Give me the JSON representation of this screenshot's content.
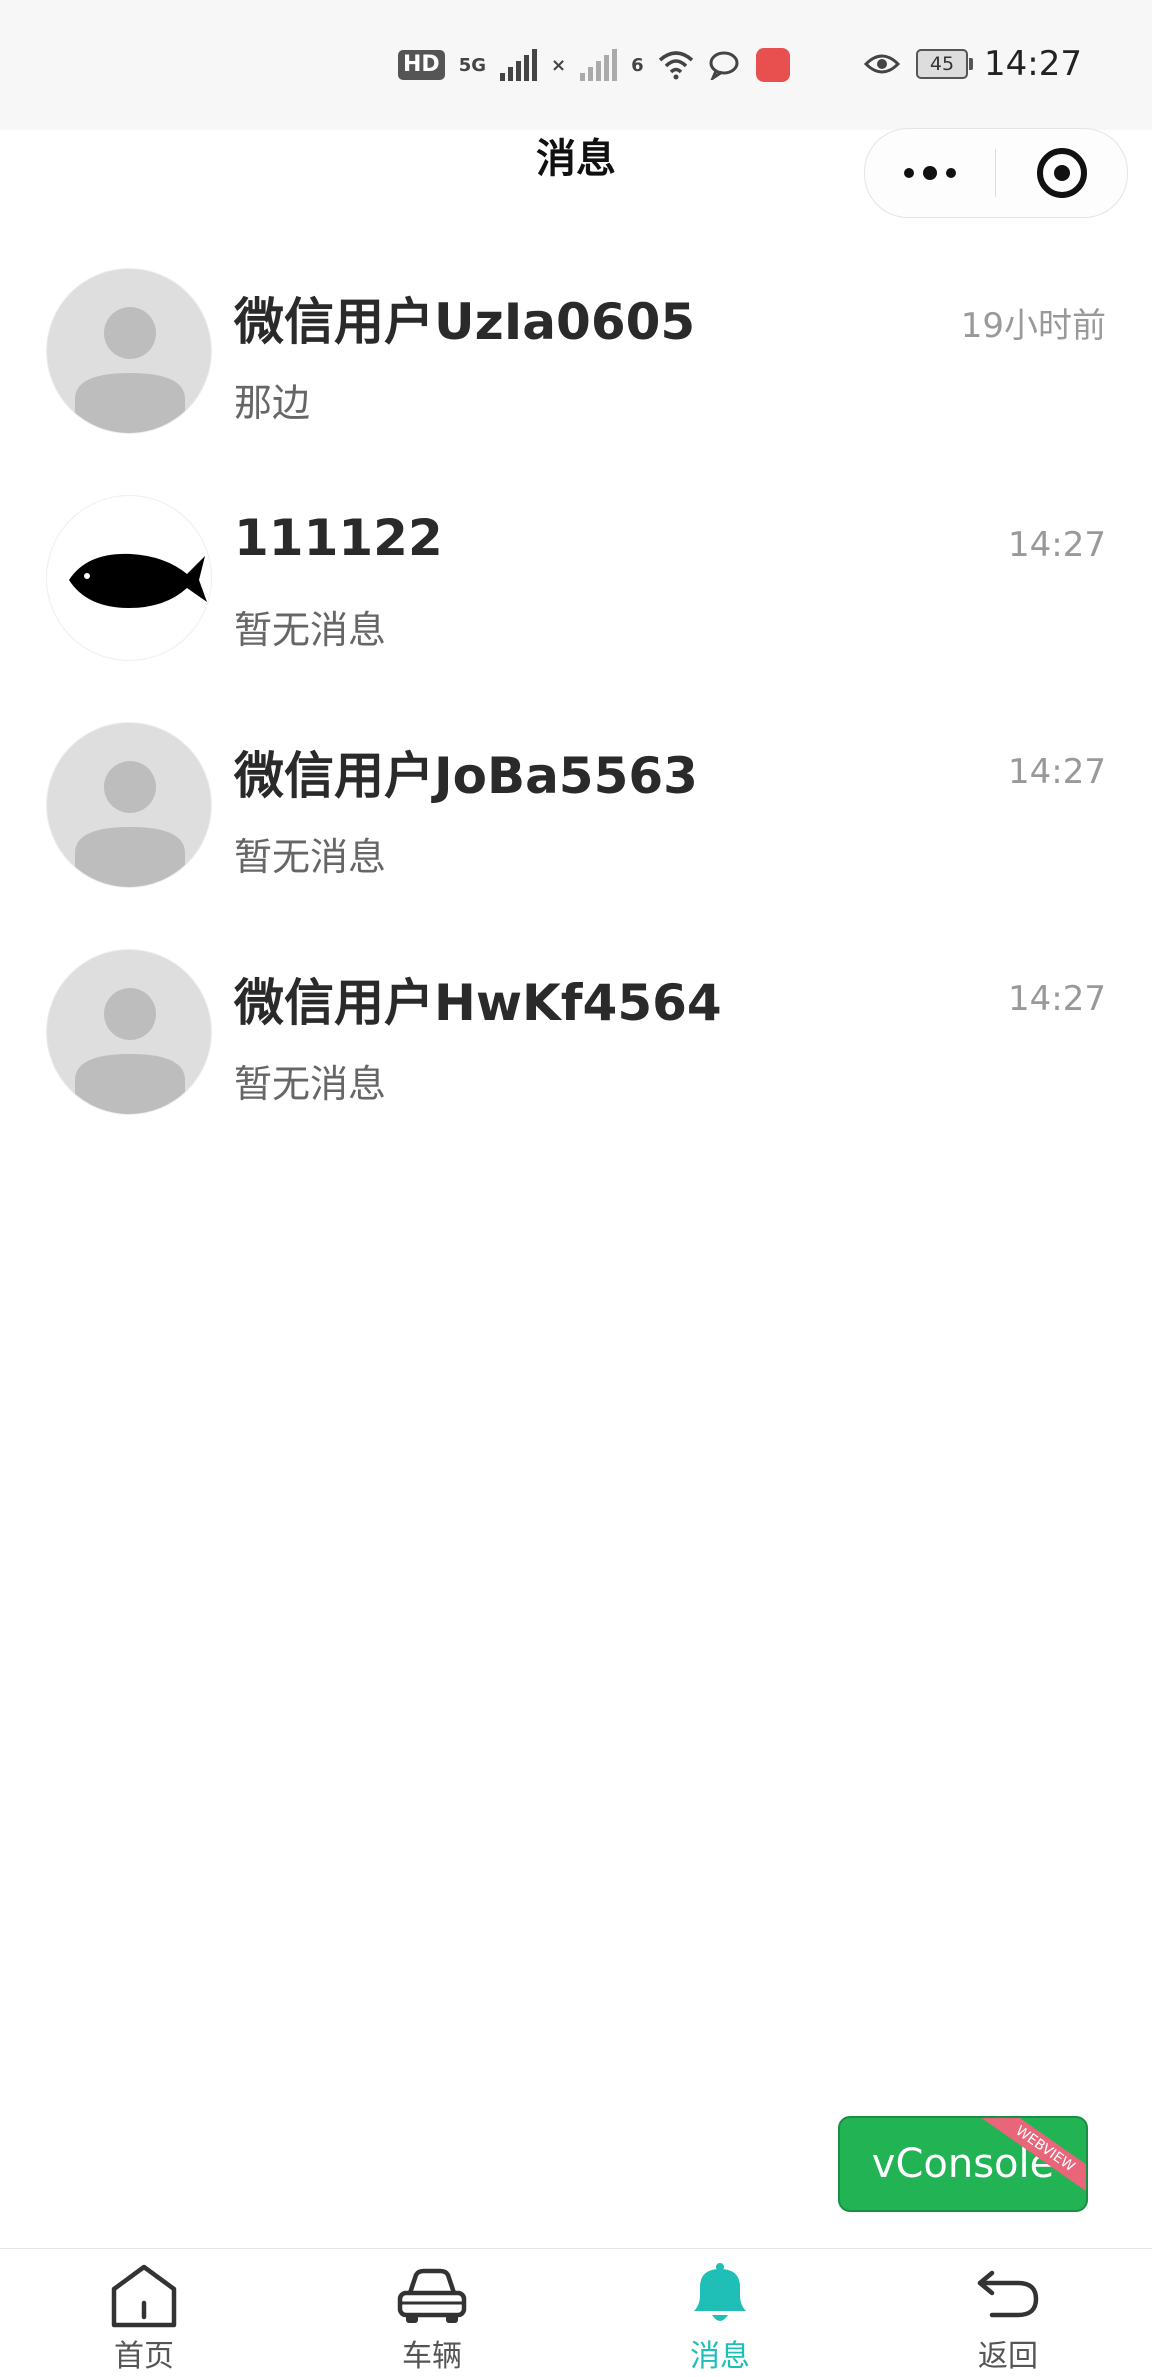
{
  "status_bar": {
    "hd_badge": "HD",
    "sim1_label": "5G",
    "sim2_label": "×",
    "wifi_label": "6",
    "battery": "45",
    "time": "14:27"
  },
  "nav": {
    "title": "消息"
  },
  "messages": [
    {
      "name": "微信用户UzIa0605",
      "preview": "那边",
      "time": "19小时前",
      "avatar": "default-avatar"
    },
    {
      "name": "111122",
      "preview": "暂无消息",
      "time": "14:27",
      "avatar": "fish-avatar"
    },
    {
      "name": "微信用户JoBa5563",
      "preview": "暂无消息",
      "time": "14:27",
      "avatar": "default-avatar"
    },
    {
      "name": "微信用户HwKf4564",
      "preview": "暂无消息",
      "time": "14:27",
      "avatar": "default-avatar"
    }
  ],
  "vconsole": {
    "label": "vConsole",
    "ribbon": "WEBVIEW"
  },
  "tabs": [
    {
      "label": "首页",
      "icon": "home-icon",
      "active": false
    },
    {
      "label": "车辆",
      "icon": "car-icon",
      "active": false
    },
    {
      "label": "消息",
      "icon": "bell-icon",
      "active": true
    },
    {
      "label": "返回",
      "icon": "return-icon",
      "active": false
    }
  ],
  "colors": {
    "accent": "#1fbfb8",
    "vconsole_green": "#22b355",
    "nav_background": "#f7f7f7"
  }
}
